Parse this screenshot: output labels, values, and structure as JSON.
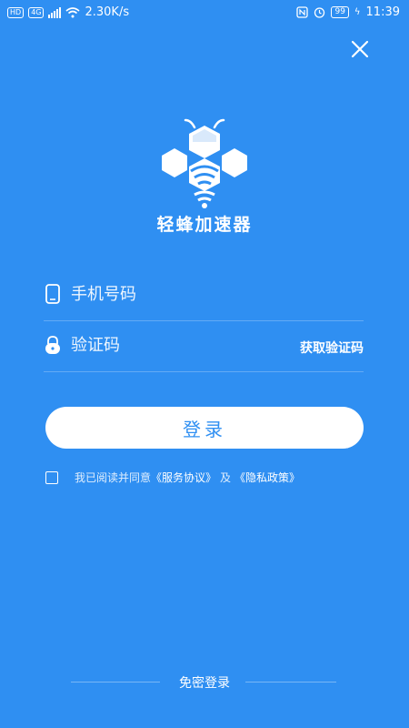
{
  "status_bar": {
    "network_badge": "HD",
    "signal_label": "4G",
    "speed": "2.30K/s",
    "battery": "99",
    "time": "11:39"
  },
  "app": {
    "name": "轻蜂加速器"
  },
  "form": {
    "phone_placeholder": "手机号码",
    "code_placeholder": "验证码",
    "get_code_label": "获取验证码",
    "login_label": "登录"
  },
  "agreement": {
    "prefix": "我已阅读并同意",
    "service_link": "《服务协议》",
    "joiner": "及",
    "privacy_link": "《隐私政策》"
  },
  "footer": {
    "passwordless_label": "免密登录"
  },
  "colors": {
    "background": "#2f8ff2",
    "button_bg": "#ffffff",
    "button_text": "#2f8ff2"
  },
  "icons": [
    "close-icon",
    "bee-logo-icon",
    "phone-icon",
    "lock-icon",
    "wifi-icon",
    "signal-icon",
    "battery-icon"
  ]
}
